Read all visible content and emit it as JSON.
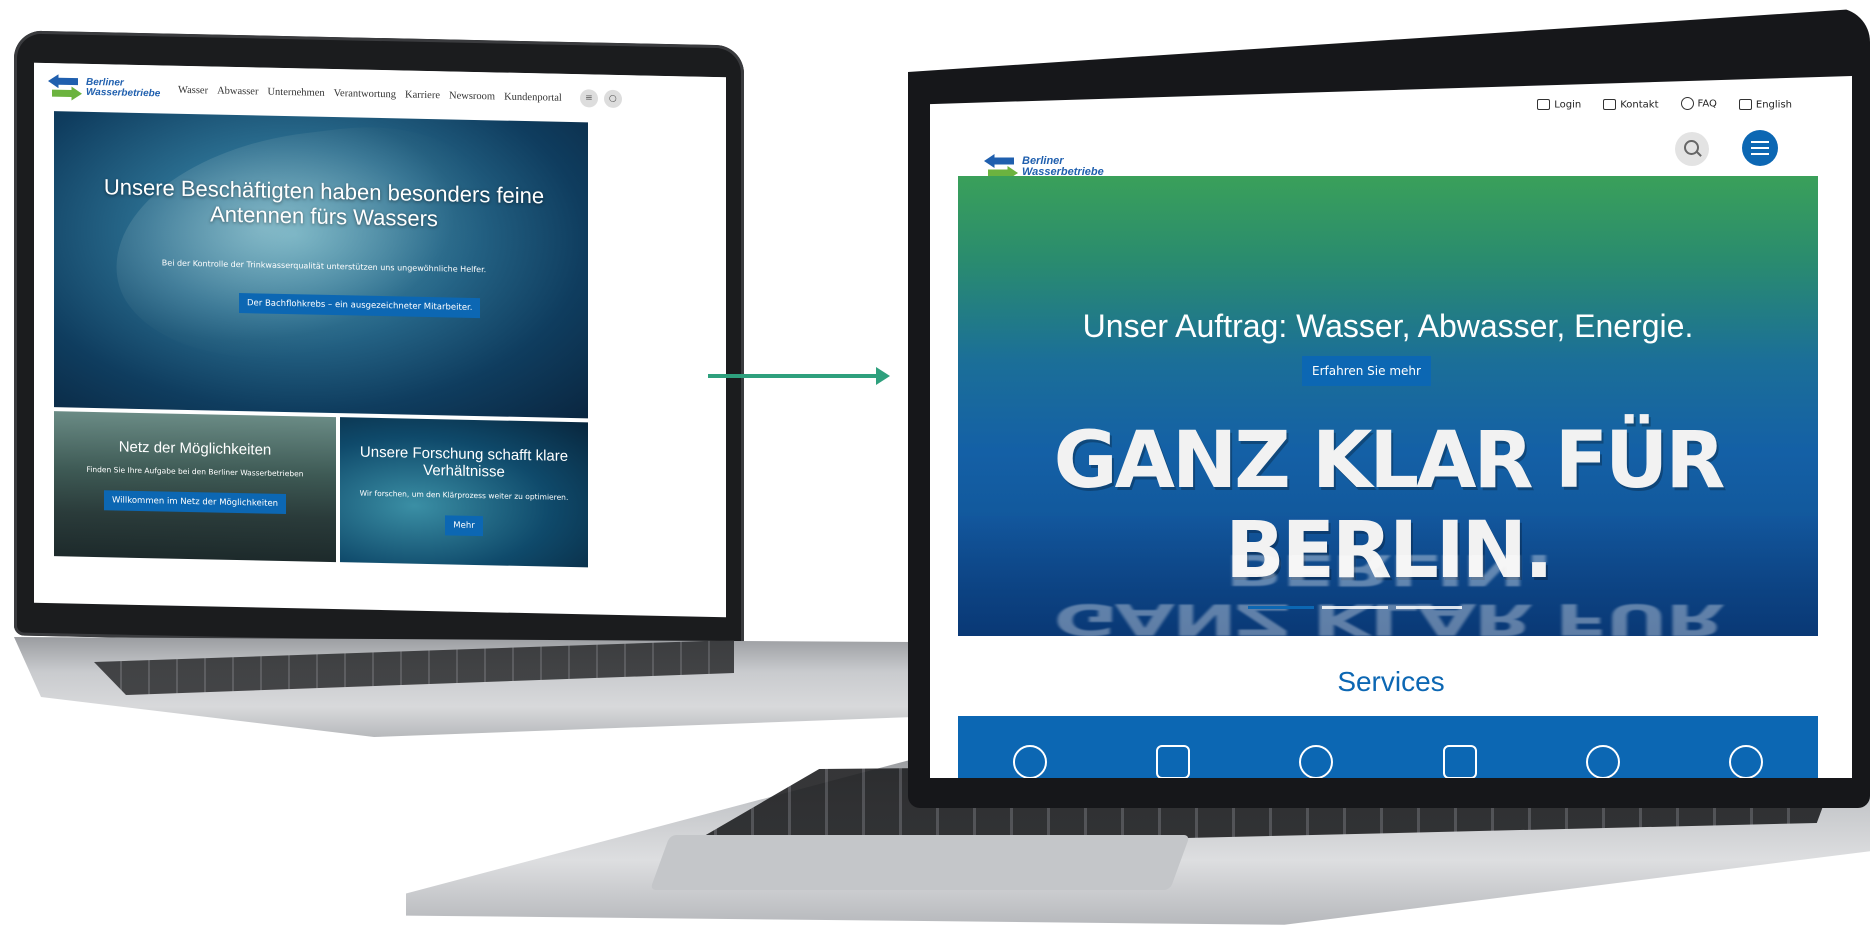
{
  "left_site": {
    "logo": "Berliner Wasserbetriebe",
    "nav": [
      "Wasser",
      "Abwasser",
      "Unternehmen",
      "Verantwortung",
      "Karriere",
      "Newsroom",
      "Kundenportal"
    ],
    "hero": {
      "title": "Unsere Beschäftigten haben besonders feine Antennen fürs Wassers",
      "subtitle": "Bei der Kontrolle der Trinkwasserqualität unterstützen uns ungewöhnliche Helfer.",
      "button": "Der Bachflohkrebs – ein ausgezeichneter Mitarbeiter."
    },
    "tiles": [
      {
        "title": "Netz der Möglichkeiten",
        "subtitle": "Finden Sie Ihre Aufgabe bei den Berliner Wasserbetrieben",
        "button": "Willkommen im Netz der Möglichkeiten"
      },
      {
        "title": "Unsere Forschung schafft klare Verhältnisse",
        "subtitle": "Wir forschen, um den Klärprozess weiter zu optimieren.",
        "button": "Mehr"
      }
    ]
  },
  "right_site": {
    "utility_nav": [
      "Login",
      "Kontakt",
      "FAQ",
      "English"
    ],
    "logo": "Berliner Wasserbetriebe",
    "hero": {
      "title": "Unser Auftrag: Wasser, Abwasser, Energie.",
      "button": "Erfahren Sie mehr",
      "slogan": "GANZ KLAR FÜR BERLIN."
    },
    "services_title": "Services",
    "service_icons": [
      "people-add-icon",
      "document-wrench-icon",
      "meter-icon",
      "euro-document-icon",
      "water-check-icon",
      "person-drop-icon"
    ]
  },
  "colors": {
    "brand_blue": "#0c67b3",
    "brand_green": "#6cb33f",
    "arrow_green": "#2ea07d"
  }
}
